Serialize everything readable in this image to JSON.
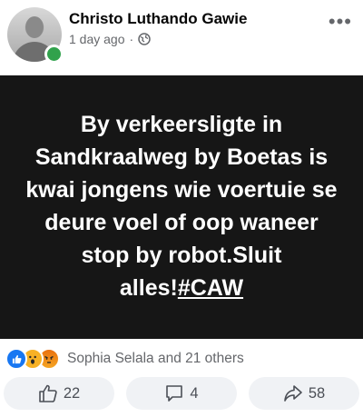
{
  "post": {
    "author": "Christo Luthando Gawie",
    "time": "1 day ago",
    "separator": "·",
    "privacy_icon": "globe-icon",
    "more_icon": "more-horizontal-icon",
    "body_text": "By verkeersligte in Sandkraalweg by Boetas is kwai jongens wie voertuie se deure voel of oop waneer stop by robot.Sluit alles!",
    "hashtag": "#CAW",
    "background_color": "#161616",
    "text_color": "#ffffff"
  },
  "reactions": {
    "icons": [
      "like-reaction-icon",
      "wow-reaction-icon",
      "angry-reaction-icon"
    ],
    "summary": "Sophia Selala and 21 others"
  },
  "actions": {
    "like_count": "22",
    "comment_count": "4",
    "share_count": "58"
  },
  "colors": {
    "online": "#31a24c",
    "like_blue": "#1877f2",
    "secondary_text": "#65676b",
    "button_bg": "#f0f2f5"
  }
}
